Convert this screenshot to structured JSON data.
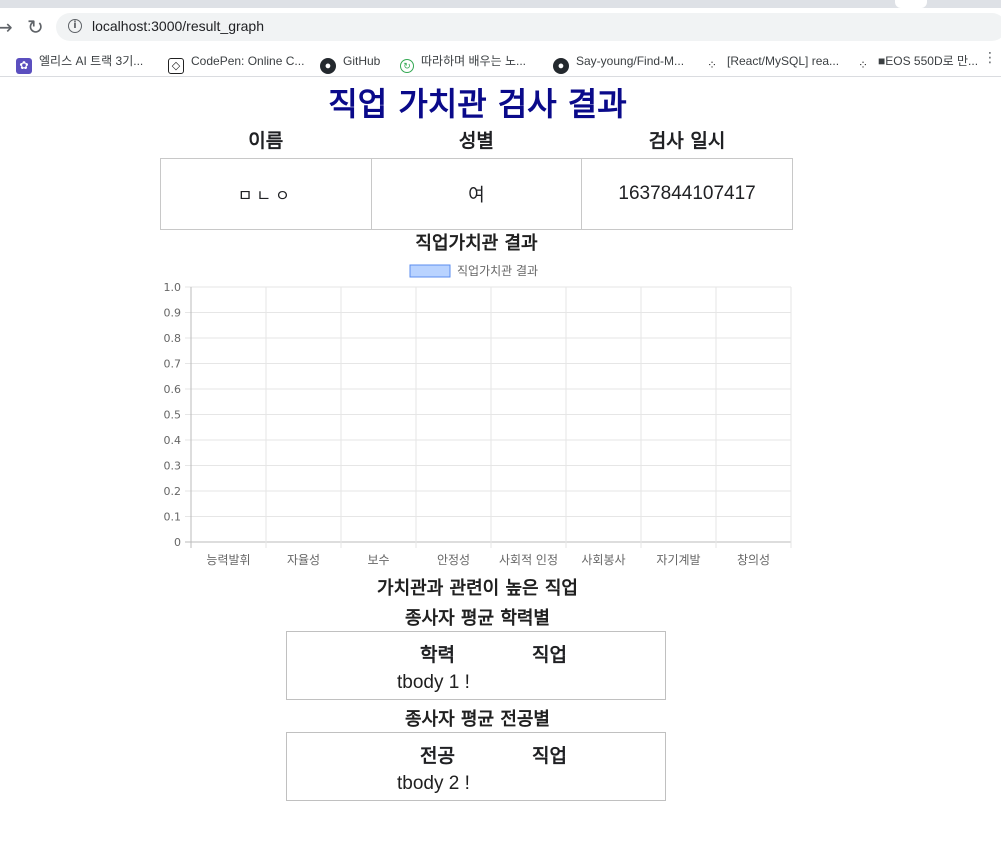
{
  "browser": {
    "url": "localhost:3000/result_graph",
    "bookmarks": [
      {
        "label": "엘리스 AI 트랙 3기...",
        "icon": "elice-icon",
        "color": "#5b4fbf"
      },
      {
        "label": "CodePen: Online C...",
        "icon": "codepen-icon",
        "color": "#222222"
      },
      {
        "label": "GitHub",
        "icon": "github-icon",
        "color": "#24292e"
      },
      {
        "label": "따라하며 배우는 노...",
        "icon": "tutorial-icon",
        "color": "#34a853"
      },
      {
        "label": "Say-young/Find-M...",
        "icon": "github-icon",
        "color": "#24292e"
      },
      {
        "label": "[React/MySQL] rea...",
        "icon": "blog-icon",
        "color": "#333333"
      },
      {
        "label": "■EOS 550D로 만...",
        "icon": "blog-icon",
        "color": "#333333"
      }
    ]
  },
  "page": {
    "title": "직업 가치관 검사 결과",
    "info": {
      "headers": [
        "이름",
        "성별",
        "검사 일시"
      ],
      "values": [
        "ㅁㄴㅇ",
        "여",
        "1637844107417"
      ]
    },
    "related_jobs_heading": "가치관과 관련이 높은 직업",
    "education": {
      "heading": "종사자 평균 학력별",
      "col1": "학력",
      "col2": "직업",
      "body": "tbody 1 !"
    },
    "major": {
      "heading": "종사자 평균 전공별",
      "col1": "전공",
      "col2": "직업",
      "body": "tbody 2 !"
    }
  },
  "chart_data": {
    "type": "bar",
    "title": "직업가치관 결과",
    "categories": [
      "능력발휘",
      "자율성",
      "보수",
      "안정성",
      "사회적 인정",
      "사회봉사",
      "자기계발",
      "창의성"
    ],
    "series": [
      {
        "name": "직업가치관 결과",
        "values": []
      }
    ],
    "ylim": [
      0,
      1
    ],
    "yticks": [
      "0",
      "0.1",
      "0.2",
      "0.3",
      "0.4",
      "0.5",
      "0.6",
      "0.7",
      "0.8",
      "0.9",
      "1.0"
    ],
    "grid": true,
    "legend": "top",
    "series_color": "#b9d3ff",
    "series_border": "#5b8def"
  }
}
